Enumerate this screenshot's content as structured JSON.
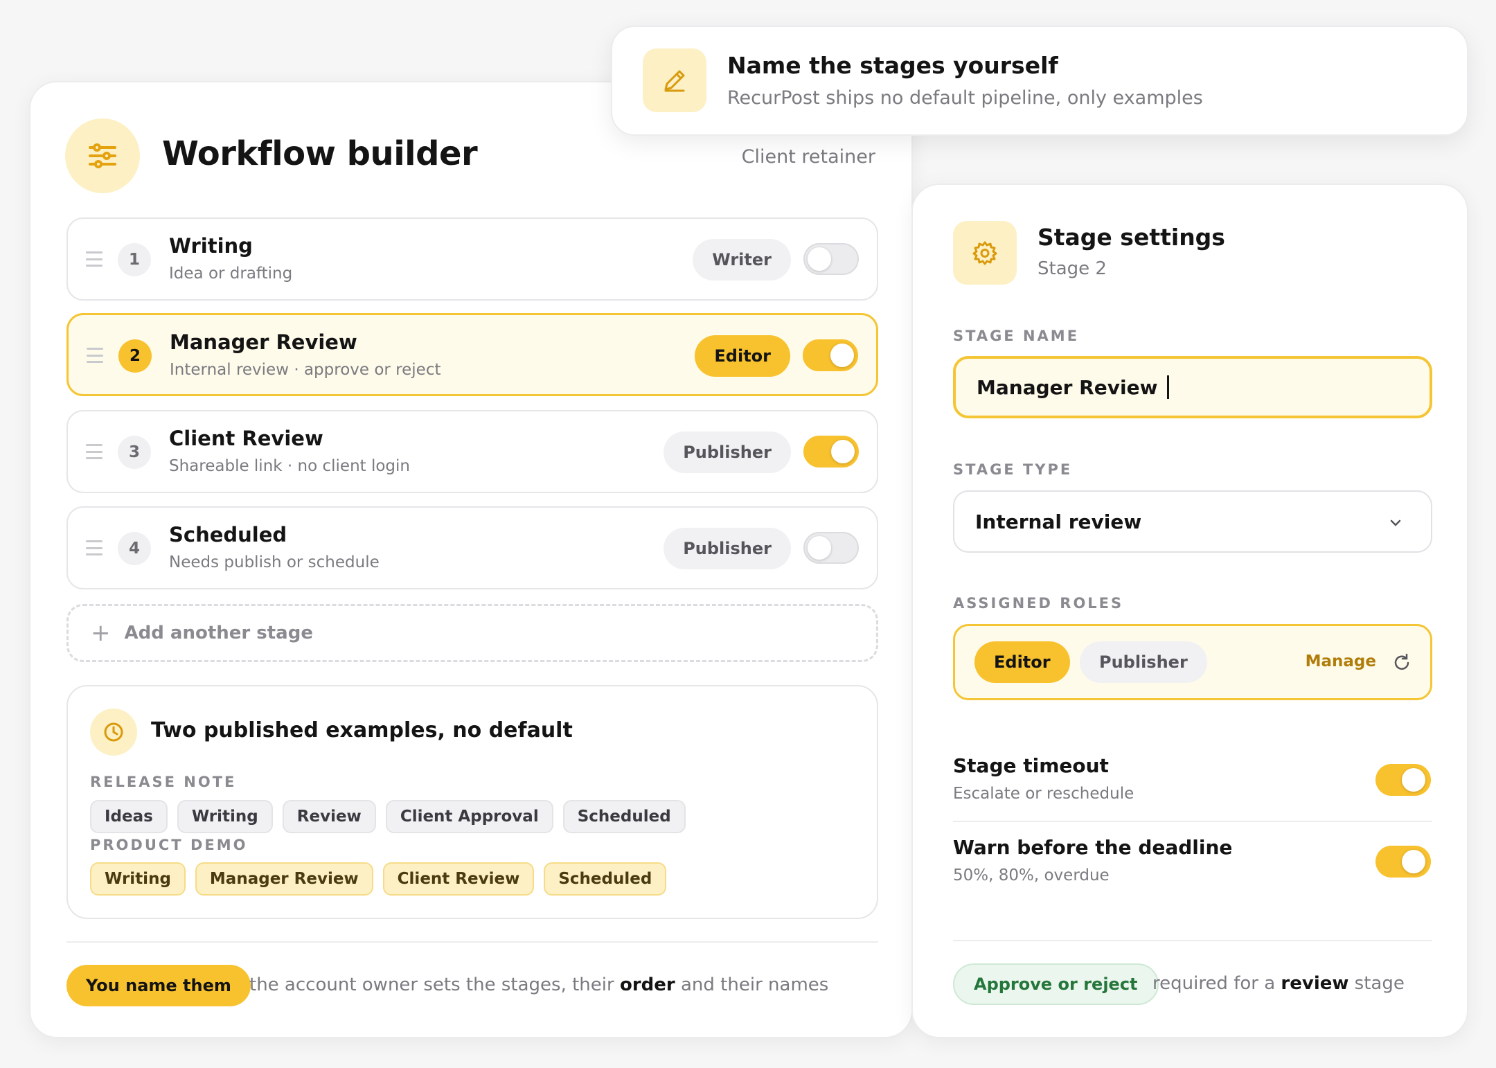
{
  "note": {
    "title": "Name the stages yourself",
    "subtitle": "RecurPost ships no default pipeline, only examples",
    "icon": "pencil-icon"
  },
  "builder": {
    "title": "Workflow builder",
    "meta": "Client retainer",
    "icon": "sliders-icon",
    "stages": [
      {
        "number": "1",
        "title": "Writing",
        "subtitle": "Idea or drafting",
        "role": "Writer",
        "enabled": false,
        "active": false
      },
      {
        "number": "2",
        "title": "Manager Review",
        "subtitle": "Internal review · approve or reject",
        "role": "Editor",
        "enabled": true,
        "active": true
      },
      {
        "number": "3",
        "title": "Client Review",
        "subtitle": "Shareable link · no client login",
        "role": "Publisher",
        "enabled": true,
        "active": false
      },
      {
        "number": "4",
        "title": "Scheduled",
        "subtitle": "Needs publish or schedule",
        "role": "Publisher",
        "enabled": false,
        "active": false
      }
    ],
    "add_stage_label": "Add another stage",
    "examples": {
      "title": "Two published examples, no default",
      "icon": "clock-icon",
      "groups": [
        {
          "label": "RELEASE NOTE",
          "chips": [
            "Ideas",
            "Writing",
            "Review",
            "Client Approval",
            "Scheduled"
          ]
        },
        {
          "label": "PRODUCT DEMO",
          "chips": [
            "Writing",
            "Manager Review",
            "Client Review",
            "Scheduled"
          ]
        }
      ]
    },
    "footer": {
      "pill": "You name them",
      "text_before": "the account owner sets the stages, their",
      "text_bold": "order",
      "text_after": "and their names"
    }
  },
  "settings": {
    "title": "Stage settings",
    "subtitle": "Stage 2",
    "icon": "gear-icon",
    "name_label": "STAGE NAME",
    "name_value": "Manager Review",
    "type_label": "STAGE TYPE",
    "type_value": "Internal review",
    "roles_label": "ASSIGNED ROLES",
    "roles": [
      "Editor",
      "Publisher"
    ],
    "manage_label": "Manage",
    "options": [
      {
        "title": "Stage timeout",
        "subtitle": "Escalate or reschedule",
        "enabled": true
      },
      {
        "title": "Warn before the deadline",
        "subtitle": "50%, 80%, overdue",
        "enabled": true
      }
    ],
    "footer": {
      "pill": "Approve or reject",
      "text_before": "required for a",
      "text_bold": "review",
      "text_after": "stage"
    }
  },
  "colors": {
    "accent": "#f8c12e",
    "accent_soft": "#fdf0c4",
    "success": "#25763a"
  }
}
